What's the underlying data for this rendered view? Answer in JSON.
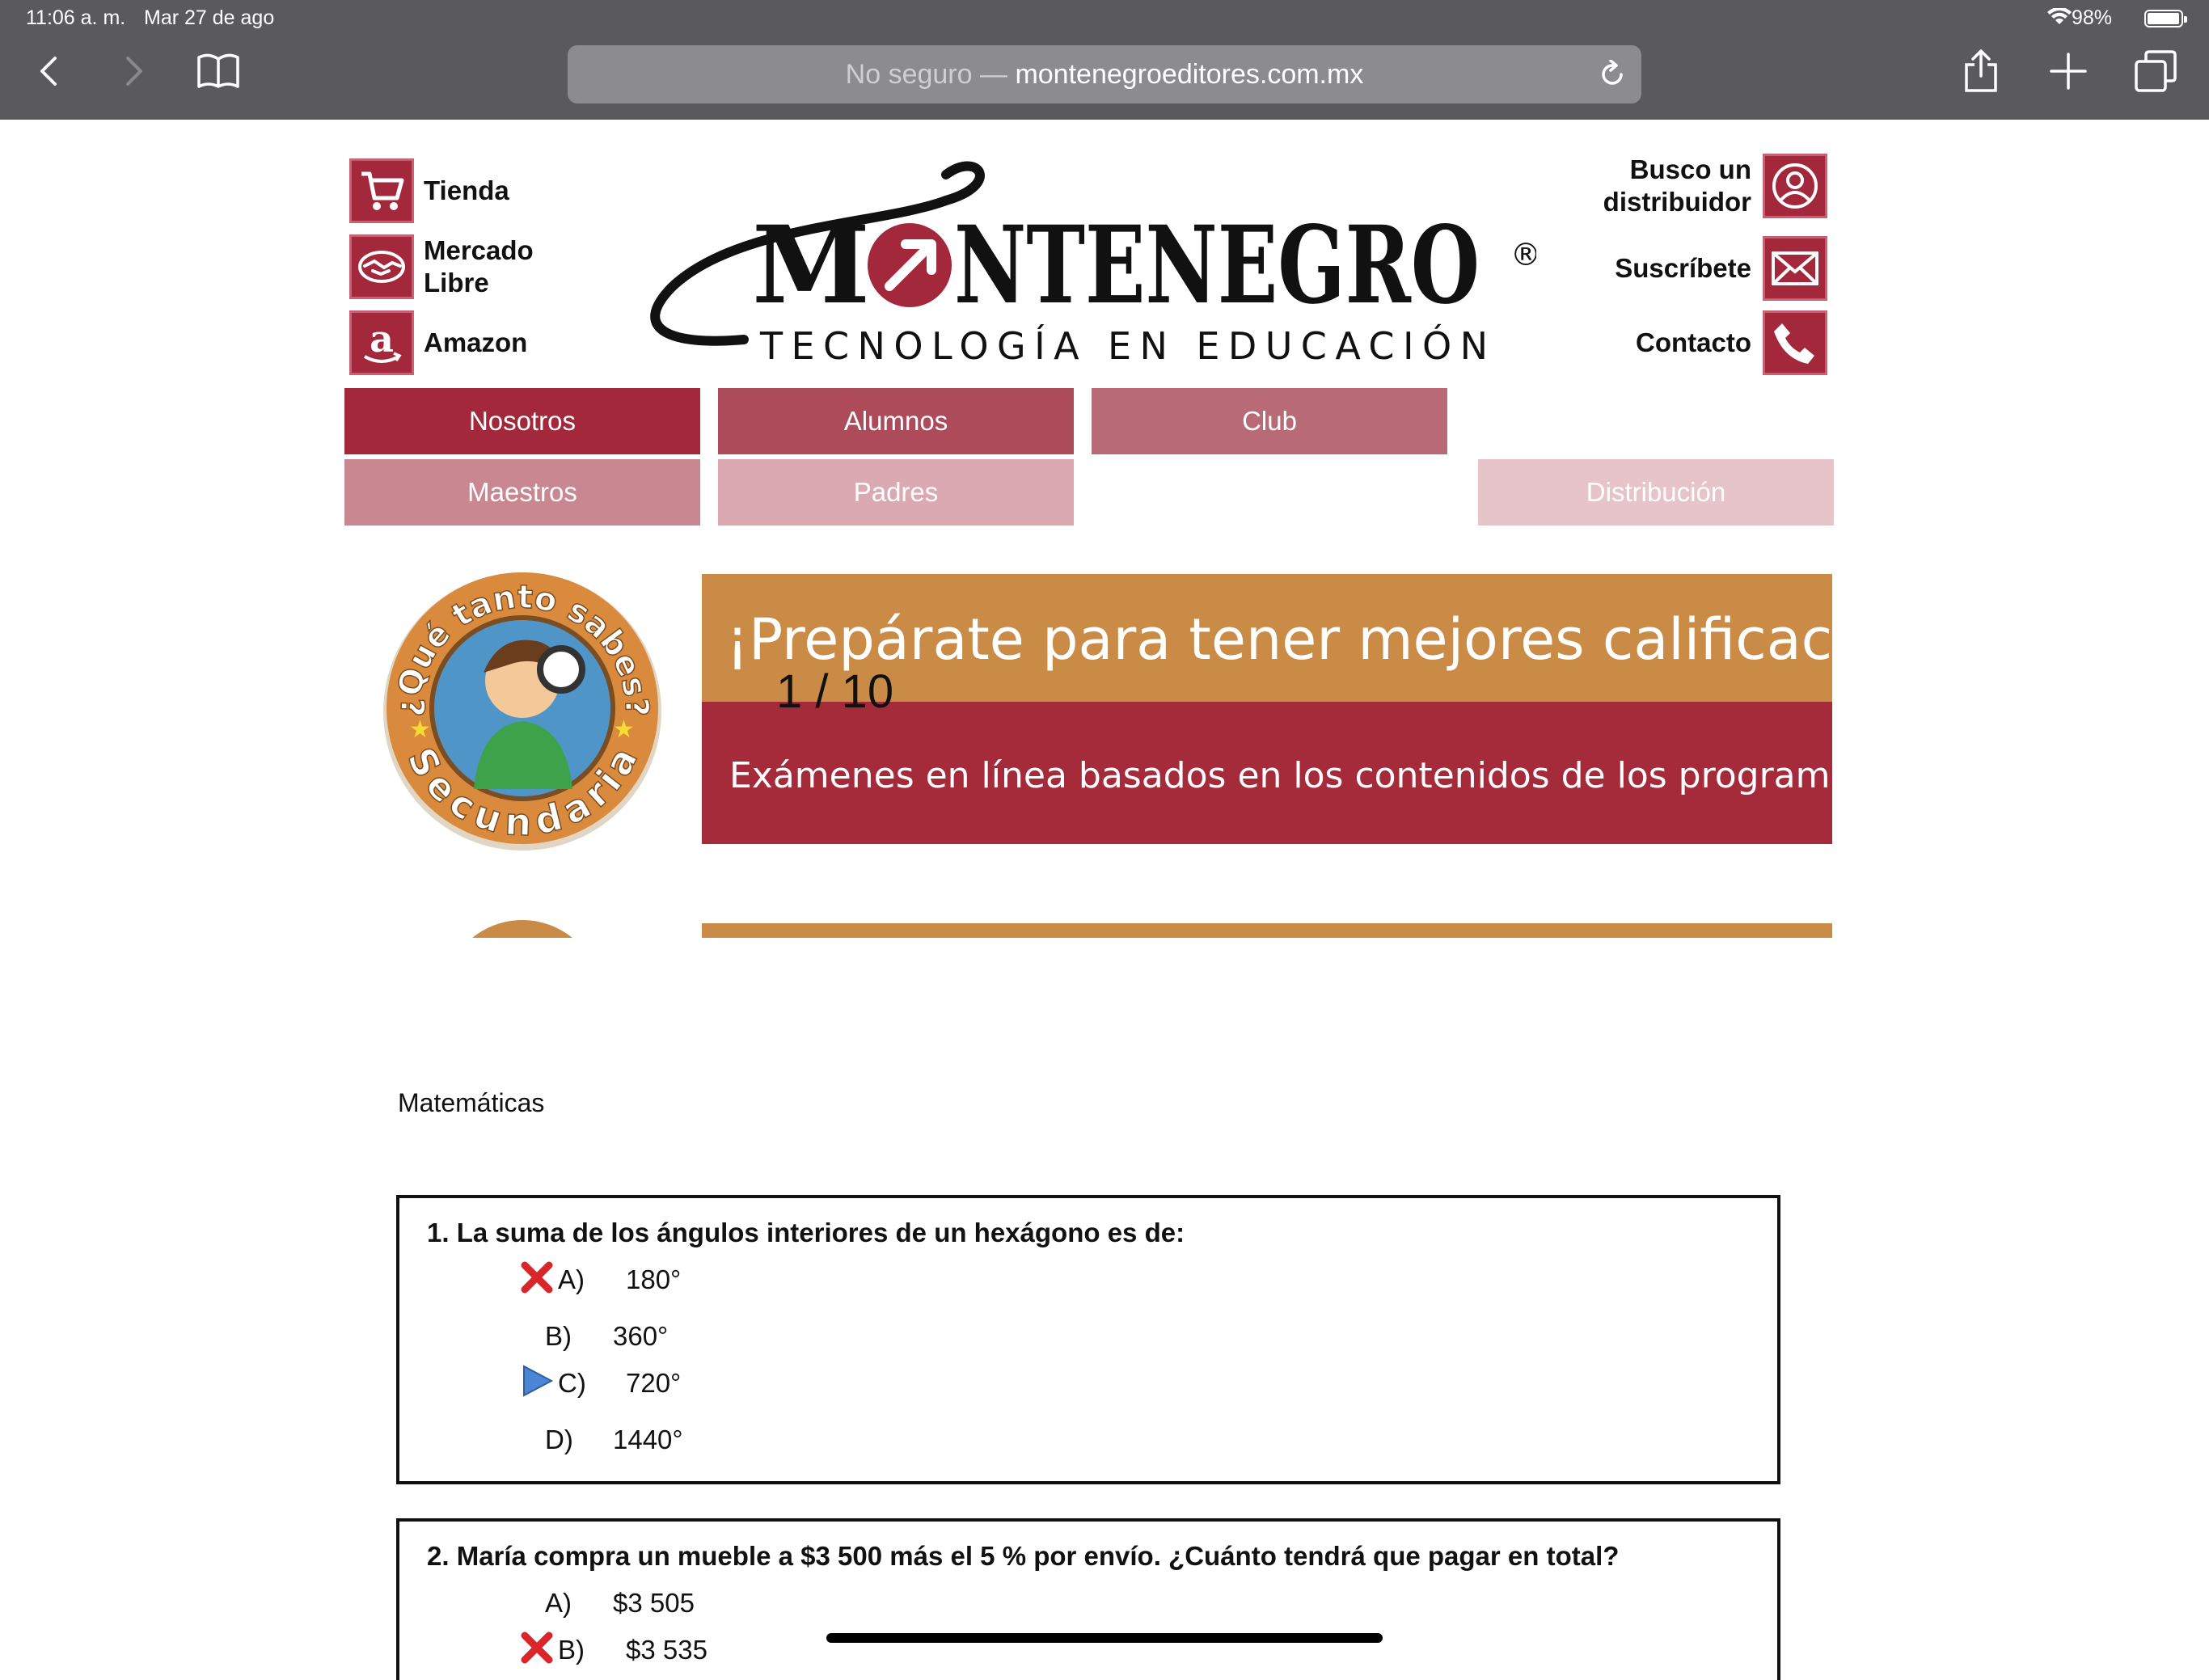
{
  "status_bar": {
    "time": "11:06 a. m.",
    "date": "Mar 27 de ago",
    "battery": "98%",
    "battery_level": 0.98
  },
  "browser": {
    "url_prefix": "No seguro — ",
    "url_domain": "montenegroeditores.com.mx"
  },
  "header": {
    "left_links": [
      {
        "label": "Tienda",
        "icon": "shopping-cart-icon"
      },
      {
        "label": "Mercado Libre",
        "icon": "handshake-icon"
      },
      {
        "label": "Amazon",
        "icon": "amazon-icon"
      }
    ],
    "right_links": [
      {
        "label": "Busco un distribuidor",
        "icon": "user-search-icon"
      },
      {
        "label": "Suscríbete",
        "icon": "envelope-icon"
      },
      {
        "label": "Contacto",
        "icon": "phone-icon"
      }
    ],
    "logo": {
      "name_part1": "M",
      "name_part2": "NTENEGRO",
      "registered": "®",
      "tagline": "TECNOLOGÍA EN EDUCACIÓN"
    }
  },
  "nav": {
    "row1": [
      {
        "label": "Nosotros",
        "color": "#a3283c"
      },
      {
        "label": "Alumnos",
        "color": "#ad4b5a"
      },
      {
        "label": "Club",
        "color": "#b86b77"
      }
    ],
    "row2": [
      {
        "label": "Maestros",
        "color": "#c98792"
      },
      {
        "label": "Padres",
        "color": "#dba9b1"
      },
      {
        "label": "Distribución",
        "color": "#e7c4c9"
      }
    ]
  },
  "slider": {
    "badge": {
      "top": "¿Qué tanto sabes?",
      "bottom": "Secundaria"
    },
    "headline": "¡Prepárate para tener mejores calificaciones!",
    "subline": "Exámenes en línea basados en los contenidos de los programas vigentes",
    "counter": "1 / 10"
  },
  "content": {
    "subject": "Matemáticas",
    "questions": [
      {
        "number": "1",
        "text": "La suma de los ángulos interiores de un hexágono es de:",
        "options": [
          {
            "letter": "A)",
            "value": "180°",
            "mark": "wrong-x-icon"
          },
          {
            "letter": "B)",
            "value": "360°",
            "mark": ""
          },
          {
            "letter": "C)",
            "value": "720°",
            "mark": "correct-arrow-icon"
          },
          {
            "letter": "D)",
            "value": "1440°",
            "mark": ""
          }
        ]
      },
      {
        "number": "2",
        "text": "María compra un mueble a $3 500 más el 5 % por envío. ¿Cuánto tendrá que pagar en total?",
        "options": [
          {
            "letter": "A)",
            "value": "$3 505",
            "mark": ""
          },
          {
            "letter": "B)",
            "value": "$3 535",
            "mark": "wrong-x-icon"
          }
        ]
      }
    ]
  },
  "colors": {
    "brand": "#a3283c",
    "banner_gold": "#c98b45",
    "banner_red": "#a52a3a",
    "chrome": "#5a5a5c"
  }
}
